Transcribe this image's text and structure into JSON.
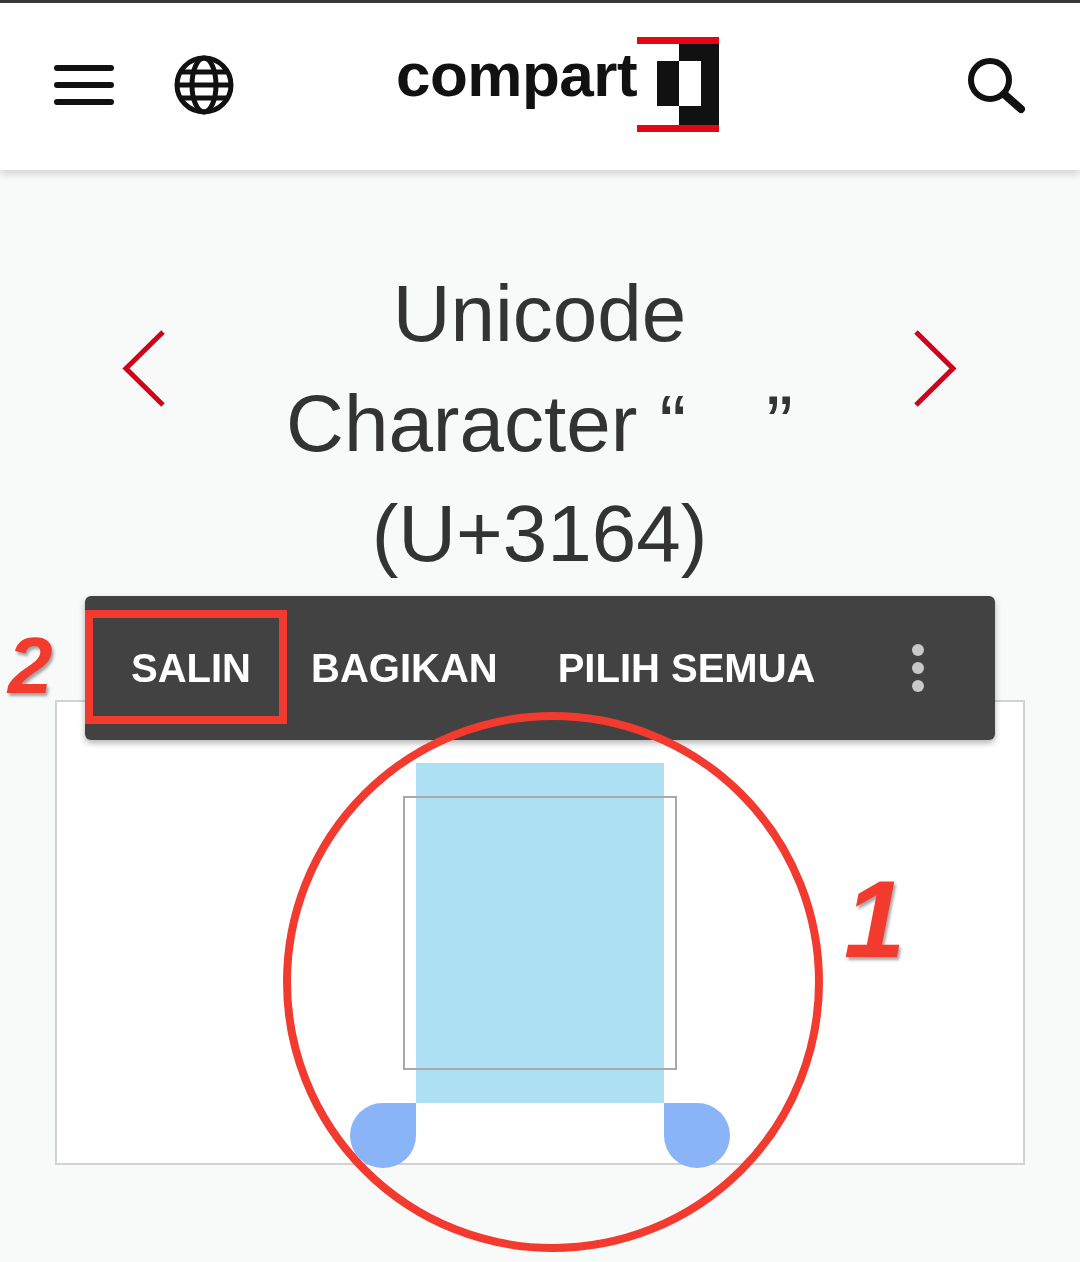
{
  "header": {
    "logo_text": "compart"
  },
  "title": "Unicode Character “ ” (U+3164)",
  "selection_toolbar": {
    "annotation": "2",
    "actions": [
      {
        "label": "SALIN",
        "highlighted": true
      },
      {
        "label": "BAGIKAN",
        "highlighted": false
      },
      {
        "label": "PILIH SEMUA",
        "highlighted": false
      }
    ]
  },
  "character_preview": {
    "selected": true,
    "annotation": "1"
  }
}
